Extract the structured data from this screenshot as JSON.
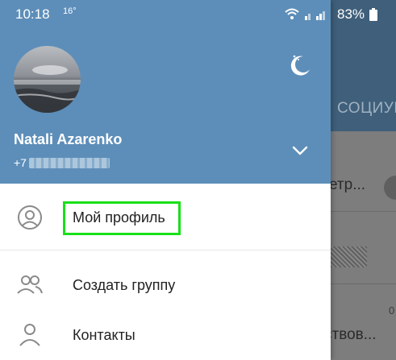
{
  "status_bar": {
    "time": "10:18",
    "temperature": "16°",
    "battery": "83%"
  },
  "background_app": {
    "tab_label": "СОЦИУМ",
    "row1_text": "етр...",
    "row2_text": "ствов...",
    "row3_small": "0"
  },
  "drawer": {
    "user_name": "Natali Azarenko",
    "phone_prefix": "+7",
    "menu": [
      {
        "label": "Мой профиль",
        "icon": "profile-icon"
      },
      {
        "label": "Создать группу",
        "icon": "group-icon"
      },
      {
        "label": "Контакты",
        "icon": "contacts-icon"
      }
    ]
  },
  "colors": {
    "header_blue": "#5d8eb9",
    "highlight_green": "#18e018"
  }
}
